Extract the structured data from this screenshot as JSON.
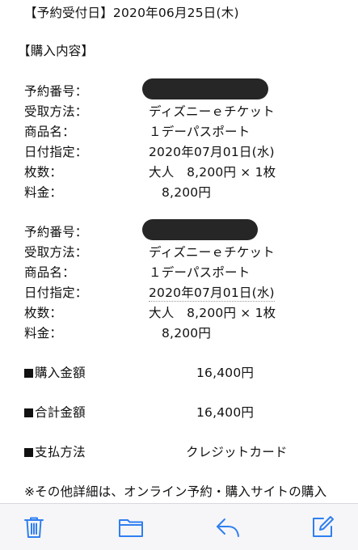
{
  "header": {
    "reception_date": "【予約受付日】2020年06月25日(木)",
    "section_title": "【購入内容】"
  },
  "orders": [
    {
      "reservation_label": "予約番号：",
      "method_label": "受取方法：",
      "method_value": "ディズニーｅチケット",
      "product_label": "商品名：",
      "product_value": "１デーパスポート",
      "date_label": "日付指定：",
      "date_value": "2020年07月01日(水)",
      "count_label": "枚数：",
      "count_value": "大人　8,200円 × 1枚",
      "fee_label": "料金：",
      "fee_value": "8,200円"
    },
    {
      "reservation_label": "予約番号：",
      "method_label": "受取方法：",
      "method_value": "ディズニーｅチケット",
      "product_label": "商品名：",
      "product_value": "１デーパスポート",
      "date_label": "日付指定：",
      "date_value": "2020年07月01日(水)",
      "count_label": "枚数：",
      "count_value": "大人　8,200円 × 1枚",
      "fee_label": "料金：",
      "fee_value": "8,200円"
    }
  ],
  "summary": {
    "purchase_label": "購入金額",
    "purchase_value": "16,400円",
    "total_label": "合計金額",
    "total_value": "16,400円",
    "payment_label": "支払方法",
    "payment_value": "クレジットカード"
  },
  "note": "※その他詳細は、オンライン予約・購入サイトの購入",
  "colors": {
    "accent": "#2f7ff0",
    "redaction": "#262626",
    "toolbar_bg": "#f6f6f8"
  },
  "toolbar": {
    "icons": [
      "trash-icon",
      "folder-icon",
      "reply-icon",
      "compose-icon"
    ]
  }
}
